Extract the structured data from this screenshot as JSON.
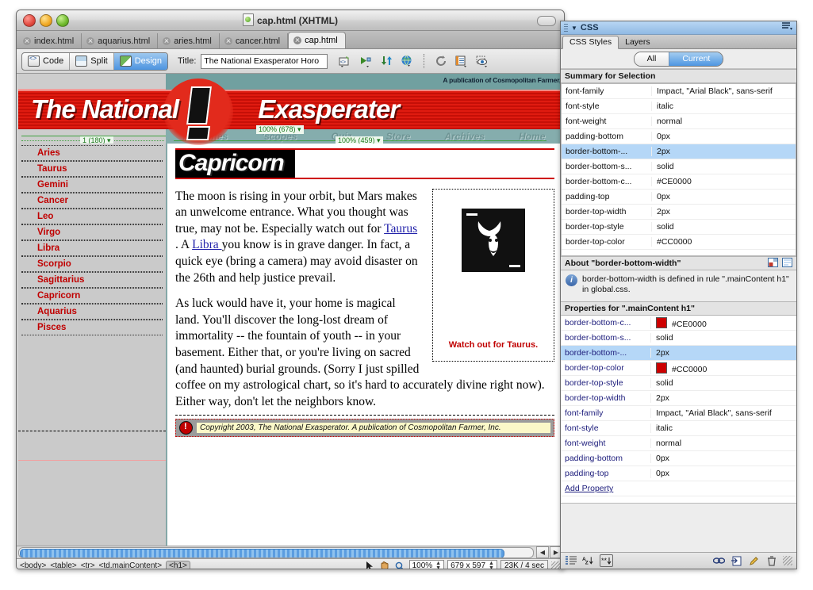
{
  "window": {
    "title": "cap.html (XHTML)",
    "doc_icon": "html-document-icon"
  },
  "file_tabs": [
    {
      "label": "index.html",
      "active": false
    },
    {
      "label": "aquarius.html",
      "active": false
    },
    {
      "label": "aries.html",
      "active": false
    },
    {
      "label": "cancer.html",
      "active": false
    },
    {
      "label": "cap.html",
      "active": true
    }
  ],
  "toolbar": {
    "view_buttons": [
      {
        "label": "Code",
        "active": false
      },
      {
        "label": "Split",
        "active": false
      },
      {
        "label": "Design",
        "active": true
      }
    ],
    "title_label": "Title:",
    "title_value": "The National Exasperator Horo",
    "icons": [
      "code-navigation-icon",
      "preview-debug-icon",
      "file-transfer-icon",
      "globe-preview-icon",
      "refresh-icon",
      "file-management-icon",
      "visual-aids-icon"
    ]
  },
  "document": {
    "masthead": {
      "publication_note": "A publication of Cosmopolitan Farmer,",
      "title_left": "The National",
      "title_right": "Exasperater",
      "nav": [
        "Headlines",
        "'scopes",
        "Quiz",
        "Store",
        "Archives",
        "Home"
      ]
    },
    "guides": {
      "column_width": "1 (180)",
      "zoom_outer": "100% (678)",
      "zoom_inner": "100% (459)"
    },
    "sidebar_links": [
      "Aries",
      "Taurus",
      "Gemini",
      "Cancer",
      "Leo",
      "Virgo",
      "Libra",
      "Scorpio",
      "Sagittarius",
      "Capricorn",
      "Aquarius",
      "Pisces"
    ],
    "heading": "Capricorn",
    "paragraph1_parts": {
      "a": "The moon is rising in your orbit, but Mars makes an unwelcome entrance. What you thought was true, may not be. Especially watch out for ",
      "link1": "Taurus ",
      "b": ". A ",
      "link2": "Libra ",
      "c": "you know is in grave danger. In fact, a quick eye (bring a camera) may avoid disaster on the 26th and help justice prevail."
    },
    "paragraph2": "As luck would have it, your home is magical land. You'll discover the long-lost dream of immortality -- the fountain of youth -- in your basement. Either that, or you're living on sacred (and haunted) burial grounds. (Sorry I just spilled coffee on my astrological chart, so it's hard to accurately divine right now). Either way, don't let the neighbors know.",
    "sidebox_caption": "Watch out for Taurus.",
    "sidebox_image": "capricorn-goat-icon",
    "footer_text": "Copyright 2003, The National Exasperator. A publication of Cosmopolitan Farmer, Inc.",
    "footer_logo": "exasperator-logo-icon"
  },
  "statusbar": {
    "tag_path": [
      "<body>",
      "<table>",
      "<tr>",
      "<td.mainContent>"
    ],
    "tag_selected": "<h1>",
    "tools": [
      "pointer-tool",
      "hand-tool",
      "zoom-tool"
    ],
    "zoom": "100%",
    "window_size": "679 x 597",
    "download_size": "23K / 4 sec"
  },
  "css_panel": {
    "title": "CSS",
    "menu_icon": "panel-options-icon",
    "tabs": [
      {
        "label": "CSS Styles",
        "active": true
      },
      {
        "label": "Layers",
        "active": false
      }
    ],
    "mode_buttons": [
      {
        "label": "All",
        "active": false
      },
      {
        "label": "Current",
        "active": true
      }
    ],
    "summary_header": "Summary for Selection",
    "summary_rows": [
      {
        "name": "font-family",
        "value": "Impact, \"Arial Black\", sans-serif",
        "selected": false
      },
      {
        "name": "font-style",
        "value": "italic",
        "selected": false
      },
      {
        "name": "font-weight",
        "value": "normal",
        "selected": false
      },
      {
        "name": "padding-bottom",
        "value": "0px",
        "selected": false
      },
      {
        "name": "border-bottom-...",
        "value": "2px",
        "selected": true
      },
      {
        "name": "border-bottom-s...",
        "value": "solid",
        "selected": false
      },
      {
        "name": "border-bottom-c...",
        "value": "#CE0000",
        "selected": false
      },
      {
        "name": "padding-top",
        "value": "0px",
        "selected": false
      },
      {
        "name": "border-top-width",
        "value": "2px",
        "selected": false
      },
      {
        "name": "border-top-style",
        "value": "solid",
        "selected": false
      },
      {
        "name": "border-top-color",
        "value": "#CC0000",
        "selected": false
      }
    ],
    "about_header": "About \"border-bottom-width\"",
    "about_icons": [
      "show-category-view-icon",
      "show-list-view-icon"
    ],
    "about_text": "border-bottom-width is defined in rule \".mainContent h1\" in global.css.",
    "properties_header": "Properties for \".mainContent h1\"",
    "properties_rows": [
      {
        "name": "border-bottom-c...",
        "value": "#CE0000",
        "swatch": "#CE0000",
        "selected": false
      },
      {
        "name": "border-bottom-s...",
        "value": "solid",
        "swatch": null,
        "selected": false
      },
      {
        "name": "border-bottom-...",
        "value": "2px",
        "swatch": null,
        "selected": true
      },
      {
        "name": "border-top-color",
        "value": "#CC0000",
        "swatch": "#CC0000",
        "selected": false
      },
      {
        "name": "border-top-style",
        "value": "solid",
        "swatch": null,
        "selected": false
      },
      {
        "name": "border-top-width",
        "value": "2px",
        "swatch": null,
        "selected": false
      },
      {
        "name": "font-family",
        "value": "Impact, \"Arial Black\", sans-serif",
        "swatch": null,
        "selected": false
      },
      {
        "name": "font-style",
        "value": "italic",
        "swatch": null,
        "selected": false
      },
      {
        "name": "font-weight",
        "value": "normal",
        "swatch": null,
        "selected": false
      },
      {
        "name": "padding-bottom",
        "value": "0px",
        "swatch": null,
        "selected": false
      },
      {
        "name": "padding-top",
        "value": "0px",
        "swatch": null,
        "selected": false
      }
    ],
    "add_property_label": "Add Property",
    "footer_left_icons": [
      "category-view-icon",
      "az-sort-icon",
      "set-properties-icon"
    ],
    "footer_right_icons": [
      "attach-stylesheet-icon",
      "new-css-rule-icon",
      "edit-style-icon",
      "delete-css-rule-icon"
    ]
  },
  "colors": {
    "accent_red": "#CC0000",
    "border_bottom_red": "#CE0000",
    "selection_blue": "#b5d7f7",
    "masthead_red": "#e01b10",
    "nav_teal": "#85adad"
  }
}
